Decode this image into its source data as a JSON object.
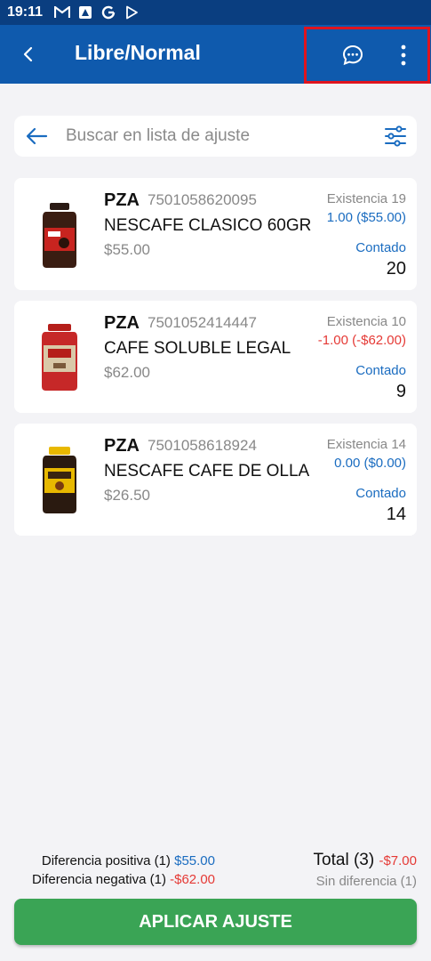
{
  "status_bar": {
    "time": "19:11",
    "icons": [
      "gmail-icon",
      "photos-icon",
      "google-icon",
      "play-store-icon"
    ]
  },
  "app_bar": {
    "title": "Libre/Normal",
    "back_icon": "chevron-left-icon",
    "actions": [
      "chat-bubble-icon",
      "more-vert-icon"
    ]
  },
  "search": {
    "placeholder": "Buscar en lista de ajuste",
    "value": ""
  },
  "items": [
    {
      "unit": "PZA",
      "barcode": "7501058620095",
      "name": "NESCAFE CLASICO 60GR",
      "price": "$55.00",
      "existence": "Existencia 19",
      "difference": "1.00 ($55.00)",
      "difference_sign": "positive",
      "counted_label": "Contado",
      "counted": "20",
      "product_image": "nescafe-clasico-jar"
    },
    {
      "unit": "PZA",
      "barcode": "7501052414447",
      "name": "CAFE SOLUBLE LEGAL",
      "price": "$62.00",
      "existence": "Existencia 10",
      "difference": "-1.00 (-$62.00)",
      "difference_sign": "negative",
      "counted_label": "Contado",
      "counted": "9",
      "product_image": "cafe-legal-jar"
    },
    {
      "unit": "PZA",
      "barcode": "7501058618924",
      "name": "NESCAFE CAFE DE OLLA",
      "price": "$26.50",
      "existence": "Existencia 14",
      "difference": "0.00 ($0.00)",
      "difference_sign": "positive",
      "counted_label": "Contado",
      "counted": "14",
      "product_image": "nescafe-de-olla-jar"
    }
  ],
  "summary": {
    "positive_label": "Diferencia positiva (1)",
    "positive_value": "$55.00",
    "negative_label": "Diferencia negativa (1)",
    "negative_value": "-$62.00",
    "total_label": "Total (3)",
    "total_value": "-$7.00",
    "no_difference": "Sin diferencia (1)"
  },
  "apply_button": "APLICAR AJUSTE",
  "colors": {
    "status_bar": "#0a3e80",
    "app_bar": "#0f5aad",
    "positive": "#1a6cc0",
    "negative": "#e53935",
    "apply": "#3aa455",
    "highlight": "#e0141e"
  }
}
